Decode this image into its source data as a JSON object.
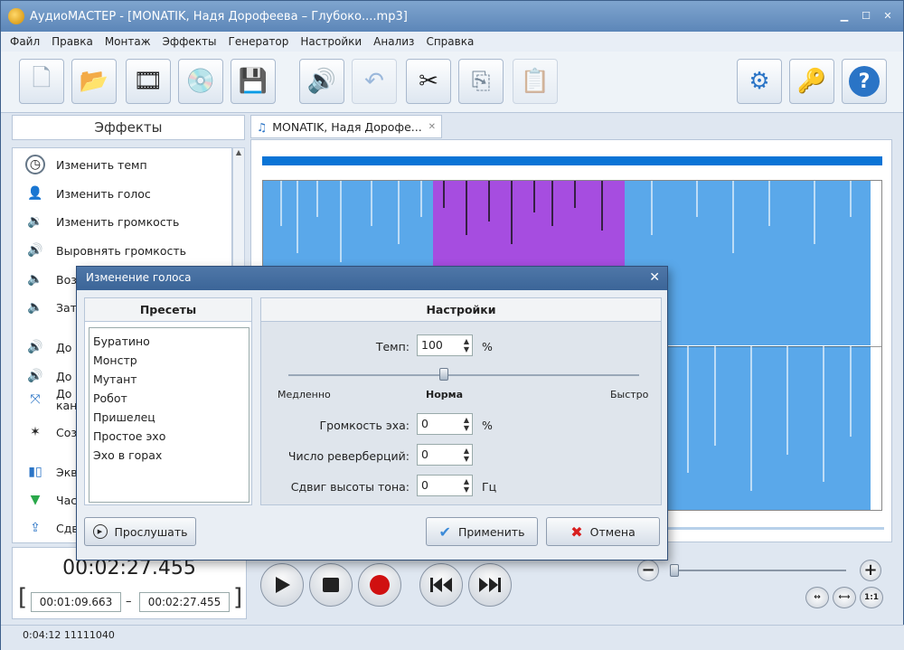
{
  "window": {
    "title": "АудиоМАСТЕР - [MONATIK, Надя Дорофеева – Глубоко....mp3]"
  },
  "menu": [
    "Файл",
    "Правка",
    "Монтаж",
    "Эффекты",
    "Генератор",
    "Настройки",
    "Анализ",
    "Справка"
  ],
  "toolbar": {
    "icons": [
      "new-file-icon",
      "open-folder-icon",
      "add-video-icon",
      "cd-icon",
      "save-icon",
      "sound-icon",
      "undo-icon",
      "cut-icon",
      "copy-icon",
      "paste-icon",
      "settings-icon",
      "key-icon",
      "help-icon"
    ]
  },
  "effects": {
    "header": "Эффекты",
    "items": [
      {
        "label": "Изменить темп"
      },
      {
        "label": "Изменить голос"
      },
      {
        "label": "Изменить громкость"
      },
      {
        "label": "Выровнять громкость"
      },
      {
        "label": "Воз"
      },
      {
        "label": "Зат"
      },
      {
        "label": "До"
      },
      {
        "label": "До"
      },
      {
        "label": "До"
      },
      {
        "label": "кан"
      },
      {
        "label": "Соз"
      },
      {
        "label": "Экв"
      },
      {
        "label": "Час"
      },
      {
        "label": "Сдв"
      }
    ]
  },
  "tab": {
    "label": "MONATIK, Надя Дорофе..."
  },
  "time": {
    "current": "00:02:27.455",
    "start": "00:01:09.663",
    "end": "00:02:27.455",
    "sep": "–",
    "bl": "[",
    "br": "]"
  },
  "status": {
    "text": "0:04:12 11111040"
  },
  "zoom": {
    "minus": "−",
    "plus": "+",
    "btn1": "↔",
    "btn2": "⟷",
    "btn3": "1:1"
  },
  "dialog": {
    "title": "Изменение голоса",
    "close": "✕",
    "presets_header": "Пресеты",
    "presets": [
      "Буратино",
      "Монстр",
      "Мутант",
      "Робот",
      "Пришелец",
      "Простое эхо",
      "Эхо в горах"
    ],
    "settings_header": "Настройки",
    "tempo_label": "Темп:",
    "tempo_value": "100",
    "tempo_unit": "%",
    "slow": "Медленно",
    "norm": "Норма",
    "fast": "Быстро",
    "echo_label": "Громкость эха:",
    "echo_value": "0",
    "echo_unit": "%",
    "reverb_label": "Число реверберций:",
    "reverb_value": "0",
    "pitch_label": "Сдвиг высоты тона:",
    "pitch_value": "0",
    "pitch_unit": "Гц",
    "listen": "Прослушать",
    "apply": "Применить",
    "cancel": "Отмена"
  }
}
